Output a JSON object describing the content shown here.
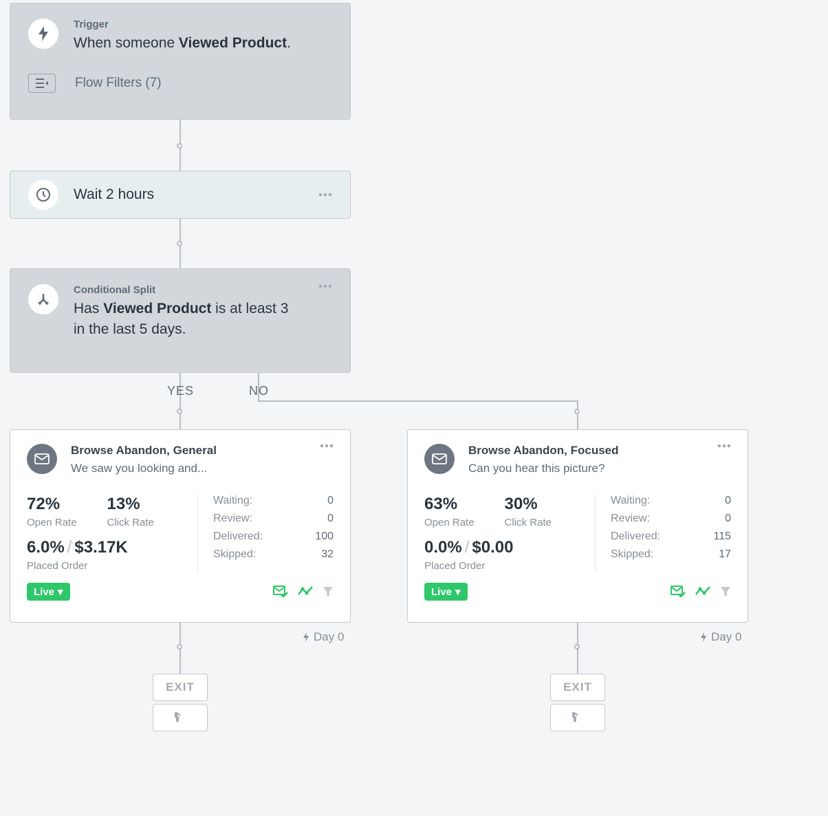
{
  "trigger": {
    "label": "Trigger",
    "text_prefix": "When someone ",
    "text_bold": "Viewed Product",
    "text_suffix": ".",
    "filters_label": "Flow Filters (7)"
  },
  "wait": {
    "text": "Wait 2 hours"
  },
  "split": {
    "label": "Conditional Split",
    "text_prefix": "Has ",
    "text_bold": "Viewed Product",
    "text_suffix": " is at least 3 in the last 5 days."
  },
  "branches": {
    "yes": "YES",
    "no": "NO"
  },
  "emails": [
    {
      "title": "Browse Abandon, General",
      "subject": "We saw you looking and...",
      "open_rate": "72%",
      "open_label": "Open Rate",
      "click_rate": "13%",
      "click_label": "Click Rate",
      "placed_pct": "6.0%",
      "placed_rev": "$3.17K",
      "placed_label": "Placed Order",
      "waiting_label": "Waiting:",
      "waiting": "0",
      "review_label": "Review:",
      "review": "0",
      "delivered_label": "Delivered:",
      "delivered": "100",
      "skipped_label": "Skipped:",
      "skipped": "32",
      "status": "Live",
      "day": "Day 0"
    },
    {
      "title": "Browse Abandon, Focused",
      "subject": "Can you hear this picture?",
      "open_rate": "63%",
      "open_label": "Open Rate",
      "click_rate": "30%",
      "click_label": "Click Rate",
      "placed_pct": "0.0%",
      "placed_rev": "$0.00",
      "placed_label": "Placed Order",
      "waiting_label": "Waiting:",
      "waiting": "0",
      "review_label": "Review:",
      "review": "0",
      "delivered_label": "Delivered:",
      "delivered": "115",
      "skipped_label": "Skipped:",
      "skipped": "17",
      "status": "Live",
      "day": "Day 0"
    }
  ],
  "exit_label": "EXIT"
}
